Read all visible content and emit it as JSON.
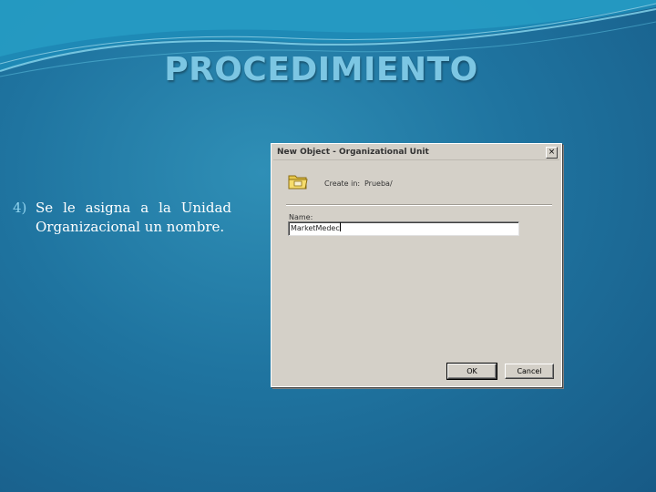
{
  "slide": {
    "title": "PROCEDIMIENTO",
    "bullet_number": "4)",
    "bullet_text": "Se le asigna a la Unidad Organizacional un nombre."
  },
  "dialog": {
    "title": "New Object - Organizational Unit",
    "close_glyph": "×",
    "created_in_label": "Create in:",
    "created_in_value": "Prueba/",
    "name_label": "Name:",
    "name_value": "MarketMedec",
    "ok_label": "OK",
    "cancel_label": "Cancel",
    "icon": "folder-icon"
  },
  "colors": {
    "background": "#1f74a0",
    "title": "#7cc6e3",
    "dialog_face": "#d4d0c8"
  }
}
